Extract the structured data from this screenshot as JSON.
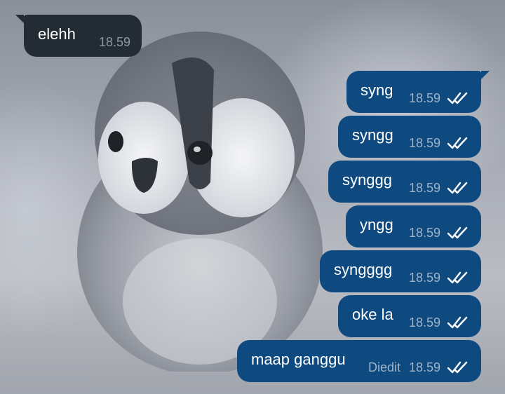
{
  "wallpaper": {
    "description_icon": "penguin-chick-wallpaper"
  },
  "colors": {
    "incoming_bubble": "#232b33",
    "outgoing_bubble": "#0e4a80",
    "text": "#ffffff",
    "meta_incoming": "#8e99a4",
    "meta_outgoing": "#9fb3c6",
    "read_check": "#ffffff"
  },
  "messages": [
    {
      "direction": "in",
      "text": "elehh",
      "time": "18.59"
    },
    {
      "direction": "out",
      "text": "syng",
      "time": "18.59",
      "status_icon": "double-check-icon"
    },
    {
      "direction": "out",
      "text": "syngg",
      "time": "18.59",
      "status_icon": "double-check-icon"
    },
    {
      "direction": "out",
      "text": "synggg",
      "time": "18.59",
      "status_icon": "double-check-icon"
    },
    {
      "direction": "out",
      "text": "yngg",
      "time": "18.59",
      "status_icon": "double-check-icon"
    },
    {
      "direction": "out",
      "text": "syngggg",
      "time": "18.59",
      "status_icon": "double-check-icon"
    },
    {
      "direction": "out",
      "text": "oke la",
      "time": "18.59",
      "status_icon": "double-check-icon"
    },
    {
      "direction": "out",
      "text": "maap ganggu",
      "time": "18.59",
      "edited": "Diedit",
      "status_icon": "double-check-icon"
    }
  ]
}
